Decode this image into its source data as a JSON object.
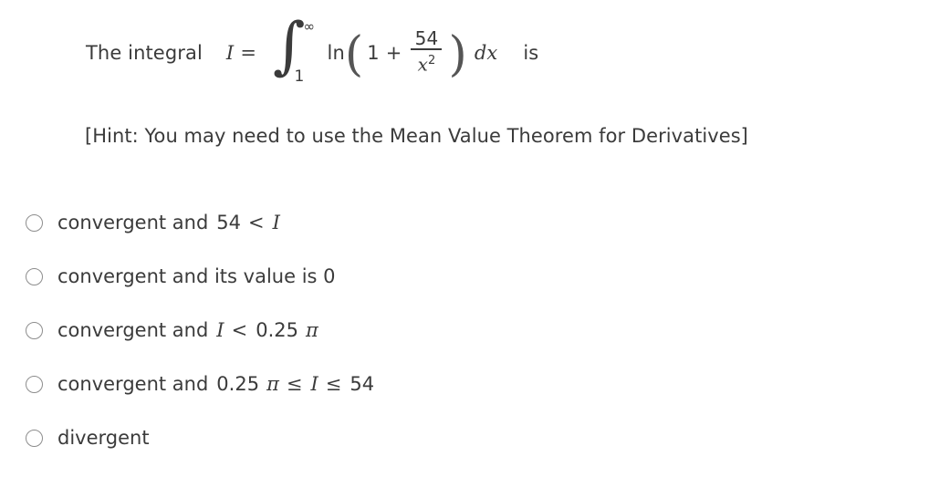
{
  "question": {
    "stem_prefix": "The integral",
    "variable": "I",
    "equals": "=",
    "integral": {
      "sign": "∫",
      "upper_limit": "∞",
      "lower_limit": "1",
      "function_name": "ln",
      "open_paren": "(",
      "close_paren": ")",
      "first_term": "1",
      "operator": "+",
      "fraction_numerator": "54",
      "fraction_denominator": "x",
      "fraction_denominator_exponent": "2",
      "differential": "dx"
    },
    "stem_suffix": "is",
    "hint": "[Hint: You may need to use the Mean Value Theorem for Derivatives]"
  },
  "options": [
    {
      "id": "option-1",
      "text": "convergent and",
      "math_number": "54",
      "math_symbol": "<",
      "math_variable": "I",
      "selected": false
    },
    {
      "id": "option-2",
      "text": "convergent and its value is 0",
      "selected": false
    },
    {
      "id": "option-3",
      "text": "convergent and",
      "math_variable": "I",
      "math_symbol": "<",
      "math_number": "0.25",
      "math_pi": "π",
      "selected": false
    },
    {
      "id": "option-4",
      "text": "convergent and",
      "math_number": "0.25",
      "math_pi": "π",
      "math_symbol": "≤",
      "math_variable": "I",
      "math_symbol_2": "≤",
      "math_number_2": "54",
      "selected": false
    },
    {
      "id": "option-5",
      "text": "divergent",
      "selected": false
    }
  ],
  "colors": {
    "text": "#3b3b3b",
    "radio_border": "#8d8d8d",
    "background": "#ffffff"
  }
}
